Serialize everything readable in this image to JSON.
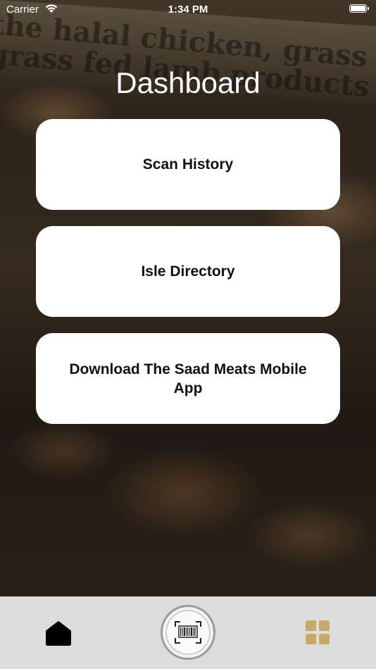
{
  "status_bar": {
    "carrier": "Carrier",
    "time": "1:34 PM",
    "icons": [
      "wifi-icon",
      "battery-icon"
    ]
  },
  "background": {
    "description_text_lines": [
      "the halal chicken, grass",
      "grass fed lamb products now"
    ]
  },
  "page": {
    "title": "Dashboard"
  },
  "menu": {
    "items": [
      {
        "label": "Scan History"
      },
      {
        "label": "Isle Directory"
      },
      {
        "label": "Download The Saad Meats Mobile App"
      }
    ]
  },
  "tab_bar": {
    "tabs": [
      {
        "icon": "home-icon",
        "selected": true
      },
      {
        "icon": "barcode-scan-icon"
      },
      {
        "icon": "grid-icon",
        "color": "#c9a96a"
      }
    ]
  },
  "colors": {
    "accent_gold": "#c9a96a",
    "card_bg": "#ffffff",
    "tabbar_bg": "#dcdcdc"
  }
}
